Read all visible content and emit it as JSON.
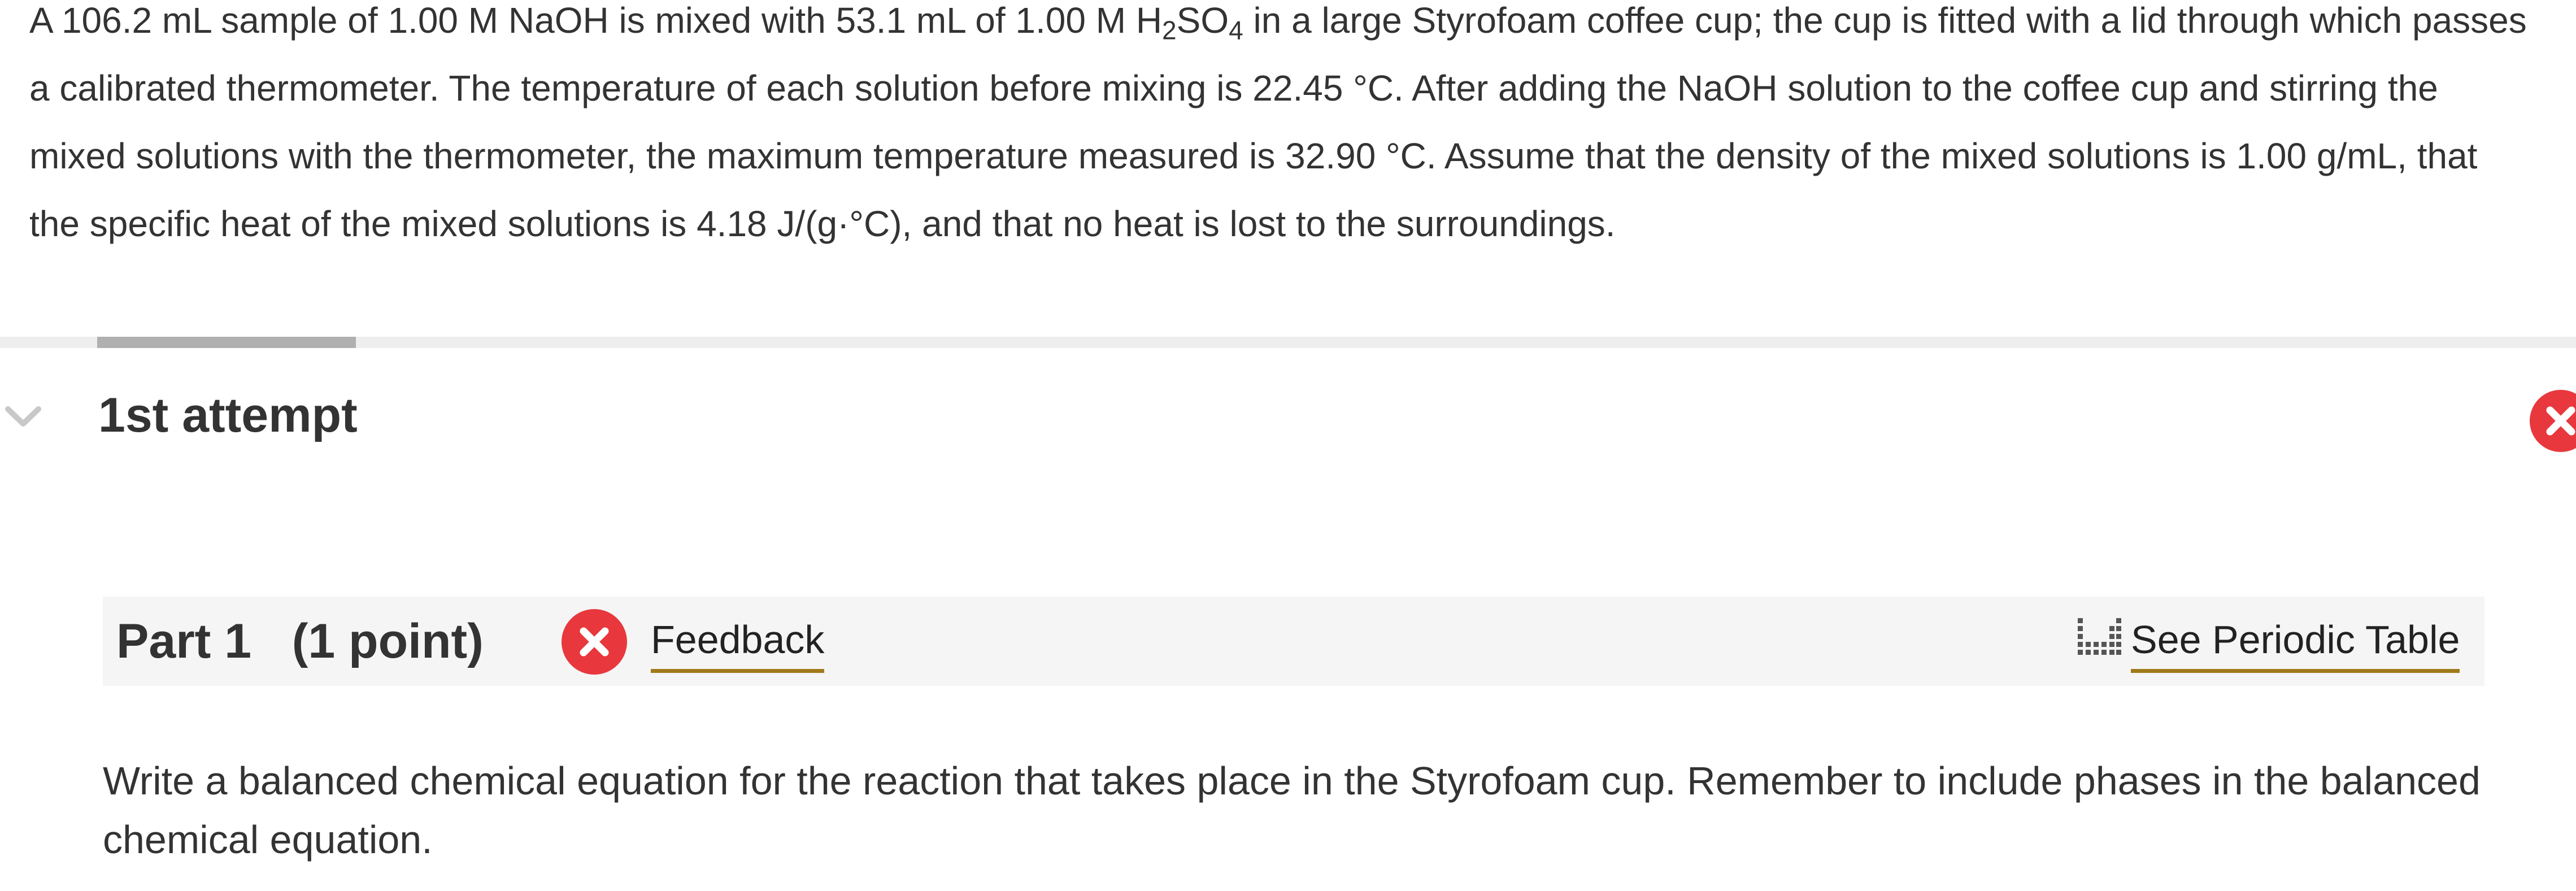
{
  "problem": {
    "part1": "A 106.2 mL sample of 1.00 M NaOH is mixed with 53.1  mL of 1.00 M H",
    "sub1": "2",
    "part2": "SO",
    "sub2": "4",
    "part3": " in a large Styrofoam coffee cup; the cup is fitted with a lid through which passes a calibrated thermometer. The temperature of each solution before mixing is 22.45 °C. After adding the NaOH solution to the coffee cup and stirring the mixed solutions with the thermometer, the maximum temperature measured is 32.90 °C. Assume that the density of the mixed solutions is 1.00 g/mL, that the specific heat of the mixed solutions is 4.18 J/(g·°C), and that no heat is lost to the surroundings."
  },
  "attempt": {
    "title": "1st attempt",
    "expanded": true,
    "status": "incorrect"
  },
  "part": {
    "title": "Part 1   (1 point)",
    "status": "incorrect",
    "feedback_label": "Feedback",
    "periodic_table_label": "See Periodic Table"
  },
  "question": {
    "text": "Write a balanced chemical equation for the reaction that takes place in the Styrofoam cup. Remember to include phases in the balanced chemical equation."
  },
  "colors": {
    "incorrect_red": "#e8383d",
    "link_underline": "#a07a1a",
    "part_bar_bg": "#f5f5f5"
  },
  "icons": {
    "chevron": "chevron-down-icon",
    "status": "close-circle-icon",
    "periodic": "periodic-table-icon"
  }
}
